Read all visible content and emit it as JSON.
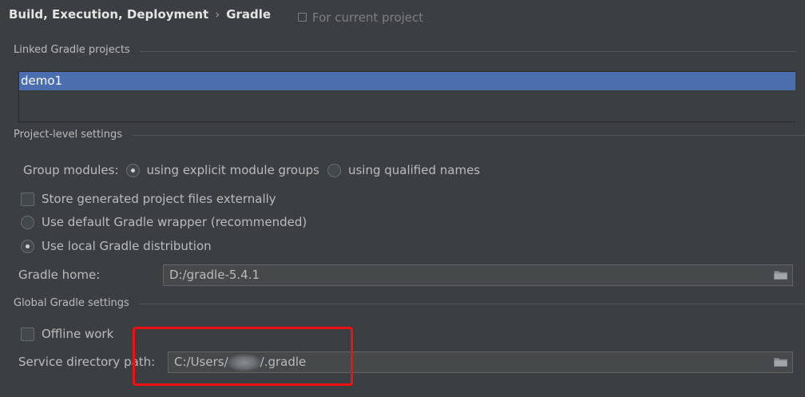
{
  "breadcrumb": {
    "parent": "Build, Execution, Deployment",
    "separator": "›",
    "current": "Gradle"
  },
  "scope_label": "For current project",
  "linked_projects": {
    "header": "Linked Gradle projects",
    "items": [
      "demo1"
    ]
  },
  "project_level": {
    "header": "Project-level settings",
    "group_modules_label": "Group modules:",
    "group_option_explicit": "using explicit module groups",
    "group_option_qualified": "using qualified names",
    "group_selected": "explicit",
    "store_externally": "Store generated project files externally",
    "use_wrapper": "Use default Gradle wrapper (recommended)",
    "use_local": "Use local Gradle distribution",
    "distribution_selected": "local",
    "gradle_home_label": "Gradle home:",
    "gradle_home_value": "D:/gradle-5.4.1"
  },
  "global": {
    "header": "Global Gradle settings",
    "offline_work": "Offline work",
    "service_dir_label": "Service directory path:",
    "service_dir_prefix": "C:/Users/",
    "service_dir_suffix": "/.gradle"
  },
  "colors": {
    "background": "#3c3f41",
    "selection": "#4b6eaf",
    "annotation": "#ee1111"
  },
  "icons": {
    "scope": "project-scope-icon",
    "browse": "folder-icon"
  }
}
